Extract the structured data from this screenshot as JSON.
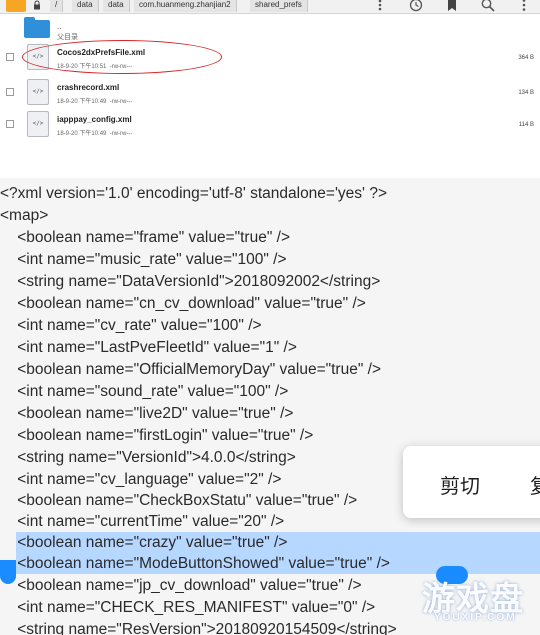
{
  "breadcrumb": [
    "/",
    "data",
    "data",
    "com.huanmeng.zhanjian2",
    "shared_prefs"
  ],
  "toolbar_icons": [
    "more-vertical-icon",
    "history-icon",
    "bookmark-icon",
    "search-icon",
    "overflow-menu-icon"
  ],
  "parent_dir": {
    "name": "..",
    "label": "父目录"
  },
  "files": [
    {
      "name": "Cocos2dxPrefsFile.xml",
      "date": "18-9-20 下午10:51",
      "perm": "-rw-rw---",
      "size": "364 B",
      "icon": "xml-file-icon"
    },
    {
      "name": "crashrecord.xml",
      "date": "18-9-20 下午10:49",
      "perm": "-rw-rw---",
      "size": "134 B",
      "icon": "xml-file-icon"
    },
    {
      "name": "iapppay_config.xml",
      "date": "18-9-20 下午10:49",
      "perm": "-rw-rw---",
      "size": "114 B",
      "icon": "xml-file-icon"
    }
  ],
  "xml_lines": [
    "<?xml version='1.0' encoding='utf-8' standalone='yes' ?>",
    "<map>",
    "    <boolean name=\"frame\" value=\"true\" />",
    "    <int name=\"music_rate\" value=\"100\" />",
    "    <string name=\"DataVersionId\">2018092002</string>",
    "    <boolean name=\"cn_cv_download\" value=\"true\" />",
    "    <int name=\"cv_rate\" value=\"100\" />",
    "    <int name=\"LastPveFleetId\" value=\"1\" />",
    "    <boolean name=\"OfficialMemoryDay\" value=\"true\" />",
    "    <int name=\"sound_rate\" value=\"100\" />",
    "    <boolean name=\"live2D\" value=\"true\" />",
    "    <boolean name=\"firstLogin\" value=\"true\" />",
    "    <string name=\"VersionId\">4.0.0</string>",
    "    <int name=\"cv_language\" value=\"2\" />",
    "    <boolean name=\"CheckBoxStatu\" value=\"true\" />",
    "    <int name=\"currentTime\" value=\"20\" />",
    "    <boolean name=\"crazy\" value=\"true\" />",
    "    <boolean name=\"ModeButtonShowed\" value=\"true\" />",
    "    <boolean name=\"jp_cv_download\" value=\"true\" />",
    "    <int name=\"CHECK_RES_MANIFEST\" value=\"0\" />",
    "    <string name=\"ResVersion\">20180920154509</string>"
  ],
  "selected_lines": [
    16,
    17
  ],
  "context_menu": {
    "items": [
      "剪切",
      "复"
    ]
  },
  "watermark": {
    "text": "游戏盘",
    "url": "YOUXIP.COM"
  },
  "colors": {
    "selection": "#b6d7ff",
    "handle": "#1a8cff",
    "annotation_ring": "#d8262a",
    "folder": "#2f8fd8",
    "app_icon": "#f6a623"
  }
}
